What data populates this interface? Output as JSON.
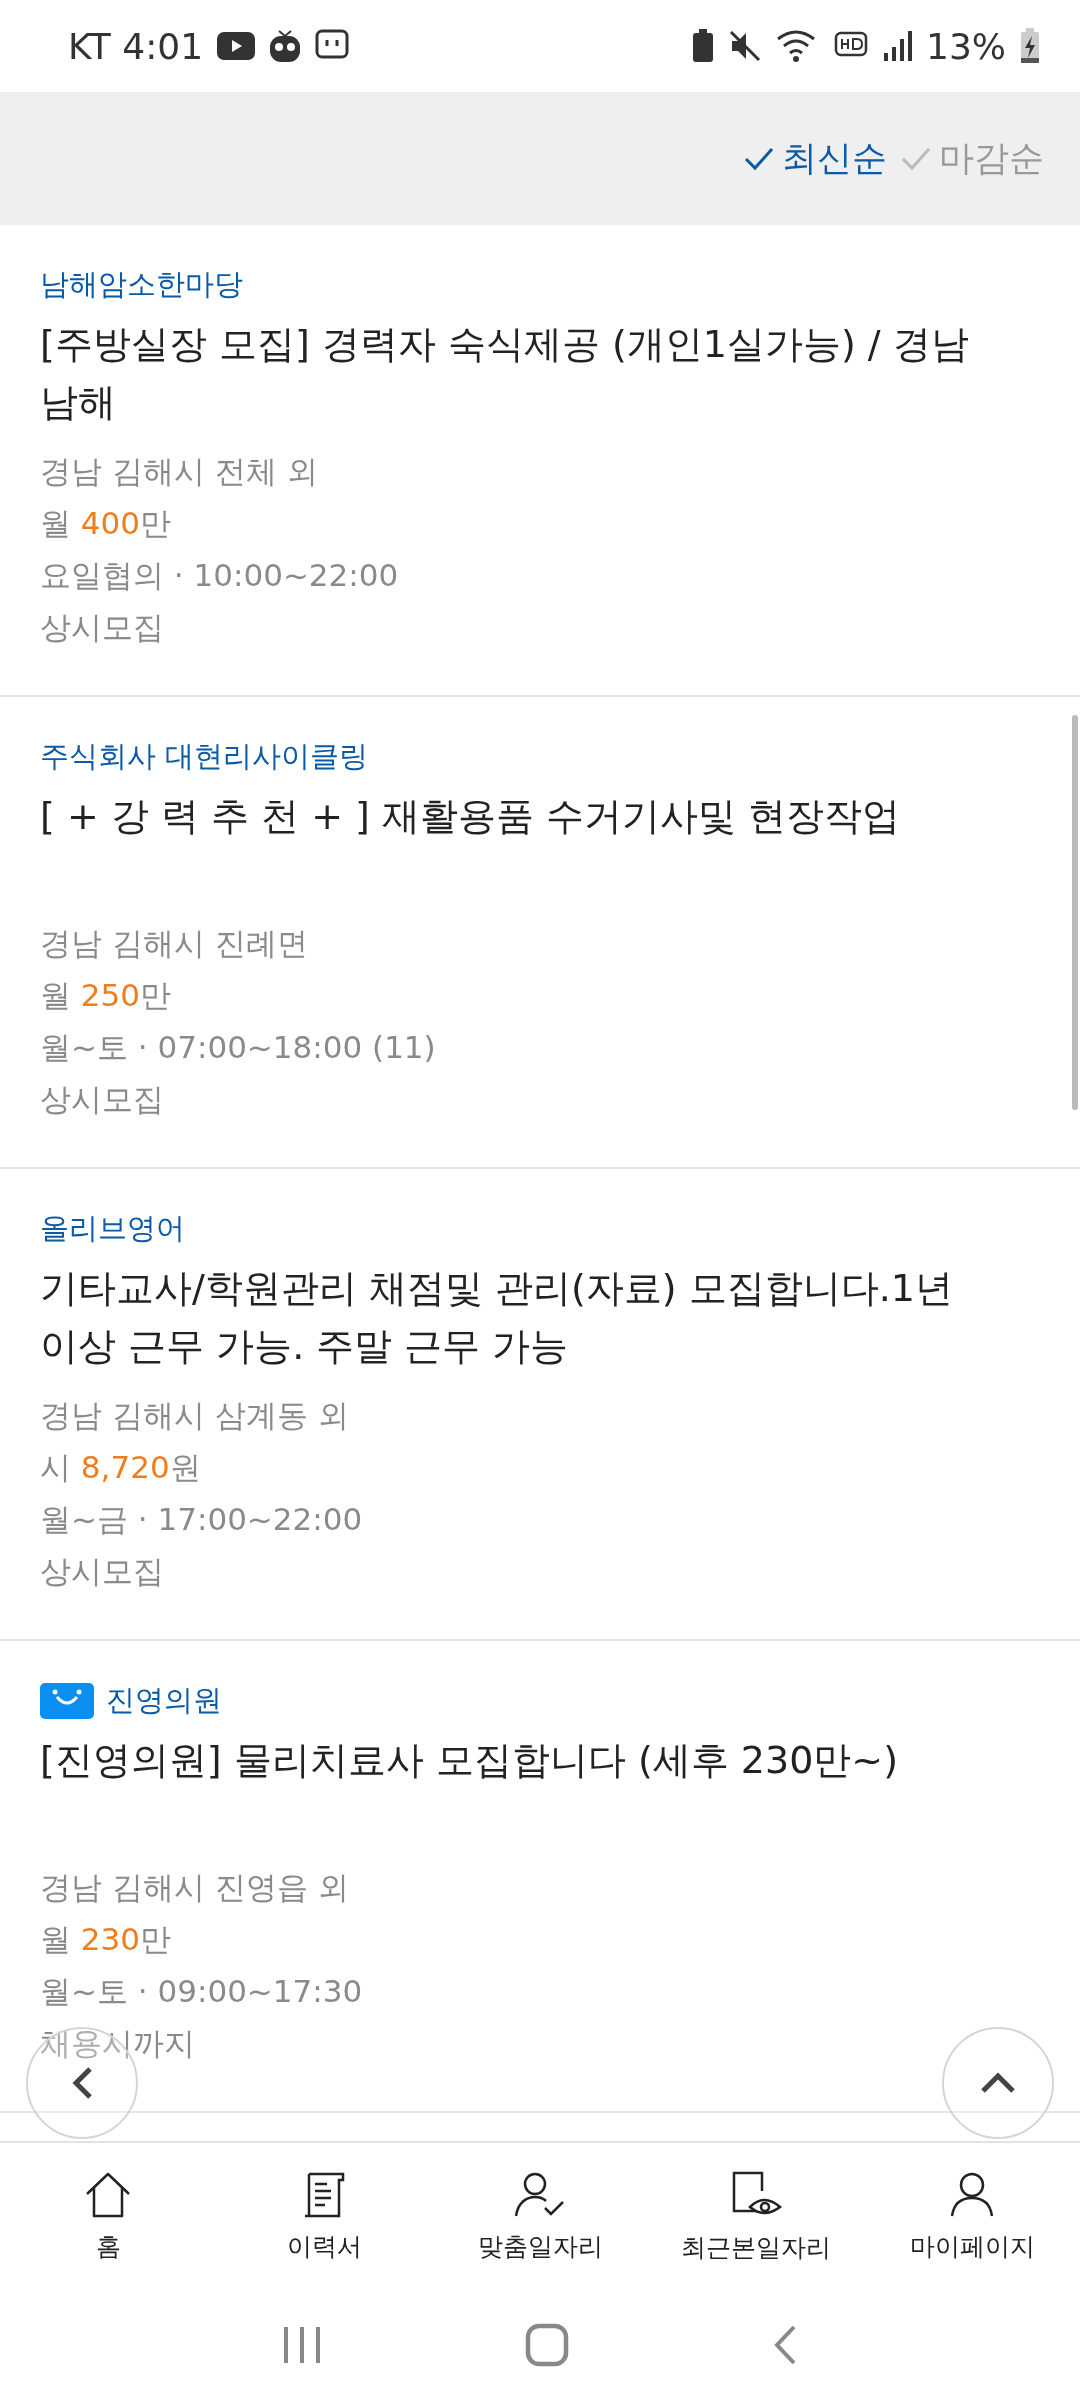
{
  "status_bar": {
    "carrier_time": "KT 4:01",
    "battery": "13%"
  },
  "sort_options": [
    {
      "label": "최신순",
      "selected": true
    },
    {
      "label": "마감순",
      "selected": false
    }
  ],
  "jobs": [
    {
      "company": "남해암소한마당",
      "logo": false,
      "title": "[주방실장 모집] 경력자 숙식제공 (개인1실가능) / 경남 남해",
      "location": "경남 김해시 전체 외",
      "pay_unit": "월",
      "pay_amount": "400",
      "pay_suffix": "만",
      "schedule": "요일협의 · 10:00~22:00",
      "period": "상시모집"
    },
    {
      "company": "주식회사 대현리사이클링",
      "logo": false,
      "title": "[ + 강 력 추 천 + ] 재활용품 수거기사및 현장작업",
      "location": "경남 김해시 진례면",
      "pay_unit": "월",
      "pay_amount": "250",
      "pay_suffix": "만",
      "schedule": "월~토 · 07:00~18:00 (11)",
      "period": "상시모집"
    },
    {
      "company": "올리브영어",
      "logo": false,
      "title": "기타교사/학원관리 채점및 관리(자료) 모집합니다.1년 이상 근무 가능. 주말 근무 가능",
      "location": "경남 김해시 삼계동 외",
      "pay_unit": "시",
      "pay_amount": "8,720",
      "pay_suffix": "원",
      "schedule": "월~금 · 17:00~22:00",
      "period": "상시모집"
    },
    {
      "company": "진영의원",
      "logo": true,
      "title": "[진영의원] 물리치료사 모집합니다 (세후 230만~)",
      "location": "경남 김해시 진영읍 외",
      "pay_unit": "월",
      "pay_amount": "230",
      "pay_suffix": "만",
      "schedule": "월~토 · 09:00~17:30",
      "period": "채용시까지"
    }
  ],
  "bottom_nav": [
    {
      "label": "홈"
    },
    {
      "label": "이력서"
    },
    {
      "label": "맞춤일자리"
    },
    {
      "label": "최근본일자리"
    },
    {
      "label": "마이페이지"
    }
  ]
}
